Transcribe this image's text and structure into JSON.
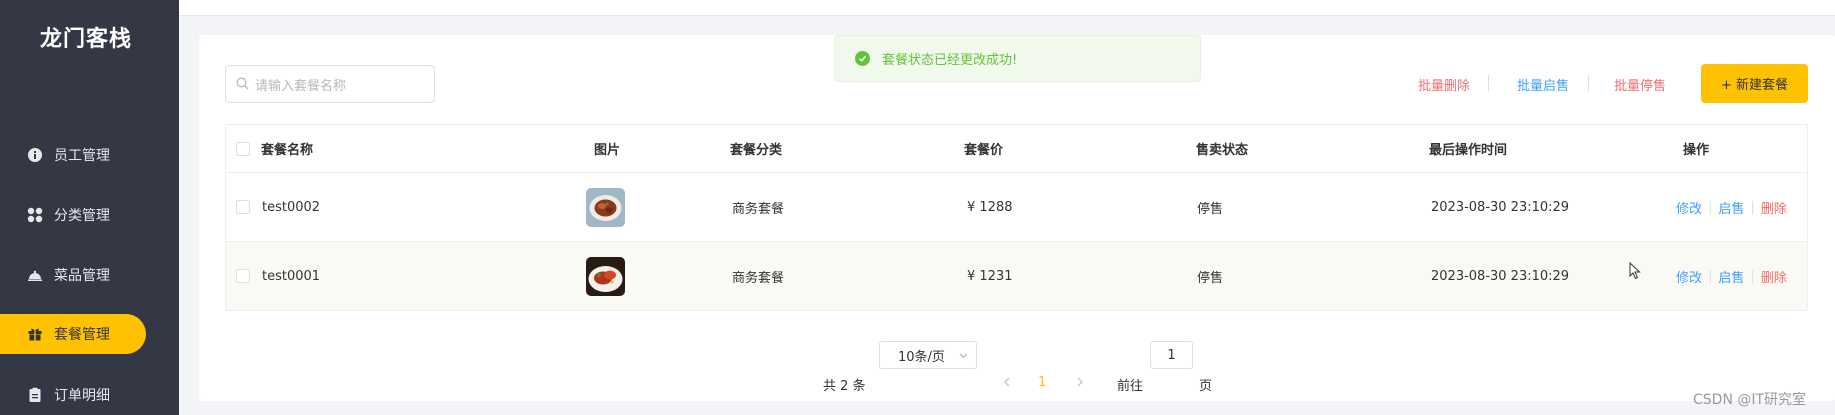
{
  "app": {
    "title": "龙门客栈"
  },
  "sidebar": {
    "items": [
      {
        "label": "员工管理",
        "icon": "info-circle-icon"
      },
      {
        "label": "分类管理",
        "icon": "grid-icon"
      },
      {
        "label": "菜品管理",
        "icon": "cloche-icon"
      },
      {
        "label": "套餐管理",
        "icon": "gift-icon",
        "active": true
      },
      {
        "label": "订单明细",
        "icon": "clipboard-icon"
      }
    ],
    "active_color": "#ffc200"
  },
  "search": {
    "placeholder": "请输入套餐名称"
  },
  "toast": {
    "message": "套餐状态已经更改成功!"
  },
  "toolbar": {
    "batch_delete": "批量删除",
    "batch_enable": "批量启售",
    "batch_disable": "批量停售",
    "new_button": "+ 新建套餐"
  },
  "table": {
    "headers": [
      "套餐名称",
      "图片",
      "套餐分类",
      "套餐价",
      "售卖状态",
      "最后操作时间",
      "操作"
    ],
    "rows": [
      {
        "name": "test0002",
        "category": "商务套餐",
        "price": "¥ 1288",
        "status": "停售",
        "updated": "2023-08-30 23:10:29"
      },
      {
        "name": "test0001",
        "category": "商务套餐",
        "price": "¥ 1231",
        "status": "停售",
        "updated": "2023-08-30 23:10:29"
      }
    ],
    "actions": {
      "edit": "修改",
      "enable": "启售",
      "delete": "删除"
    }
  },
  "pagination": {
    "total": "共 2 条",
    "page_size": "10条/页",
    "current_page": "1",
    "goto_label": "前往",
    "goto_value": "1",
    "page_suffix": "页"
  },
  "watermark": "CSDN @IT研究室",
  "colors": {
    "primary": "#ffc200",
    "sidebar_bg": "#343744",
    "link": "#419eff",
    "danger": "#f56c6c",
    "success": "#67c23a"
  }
}
